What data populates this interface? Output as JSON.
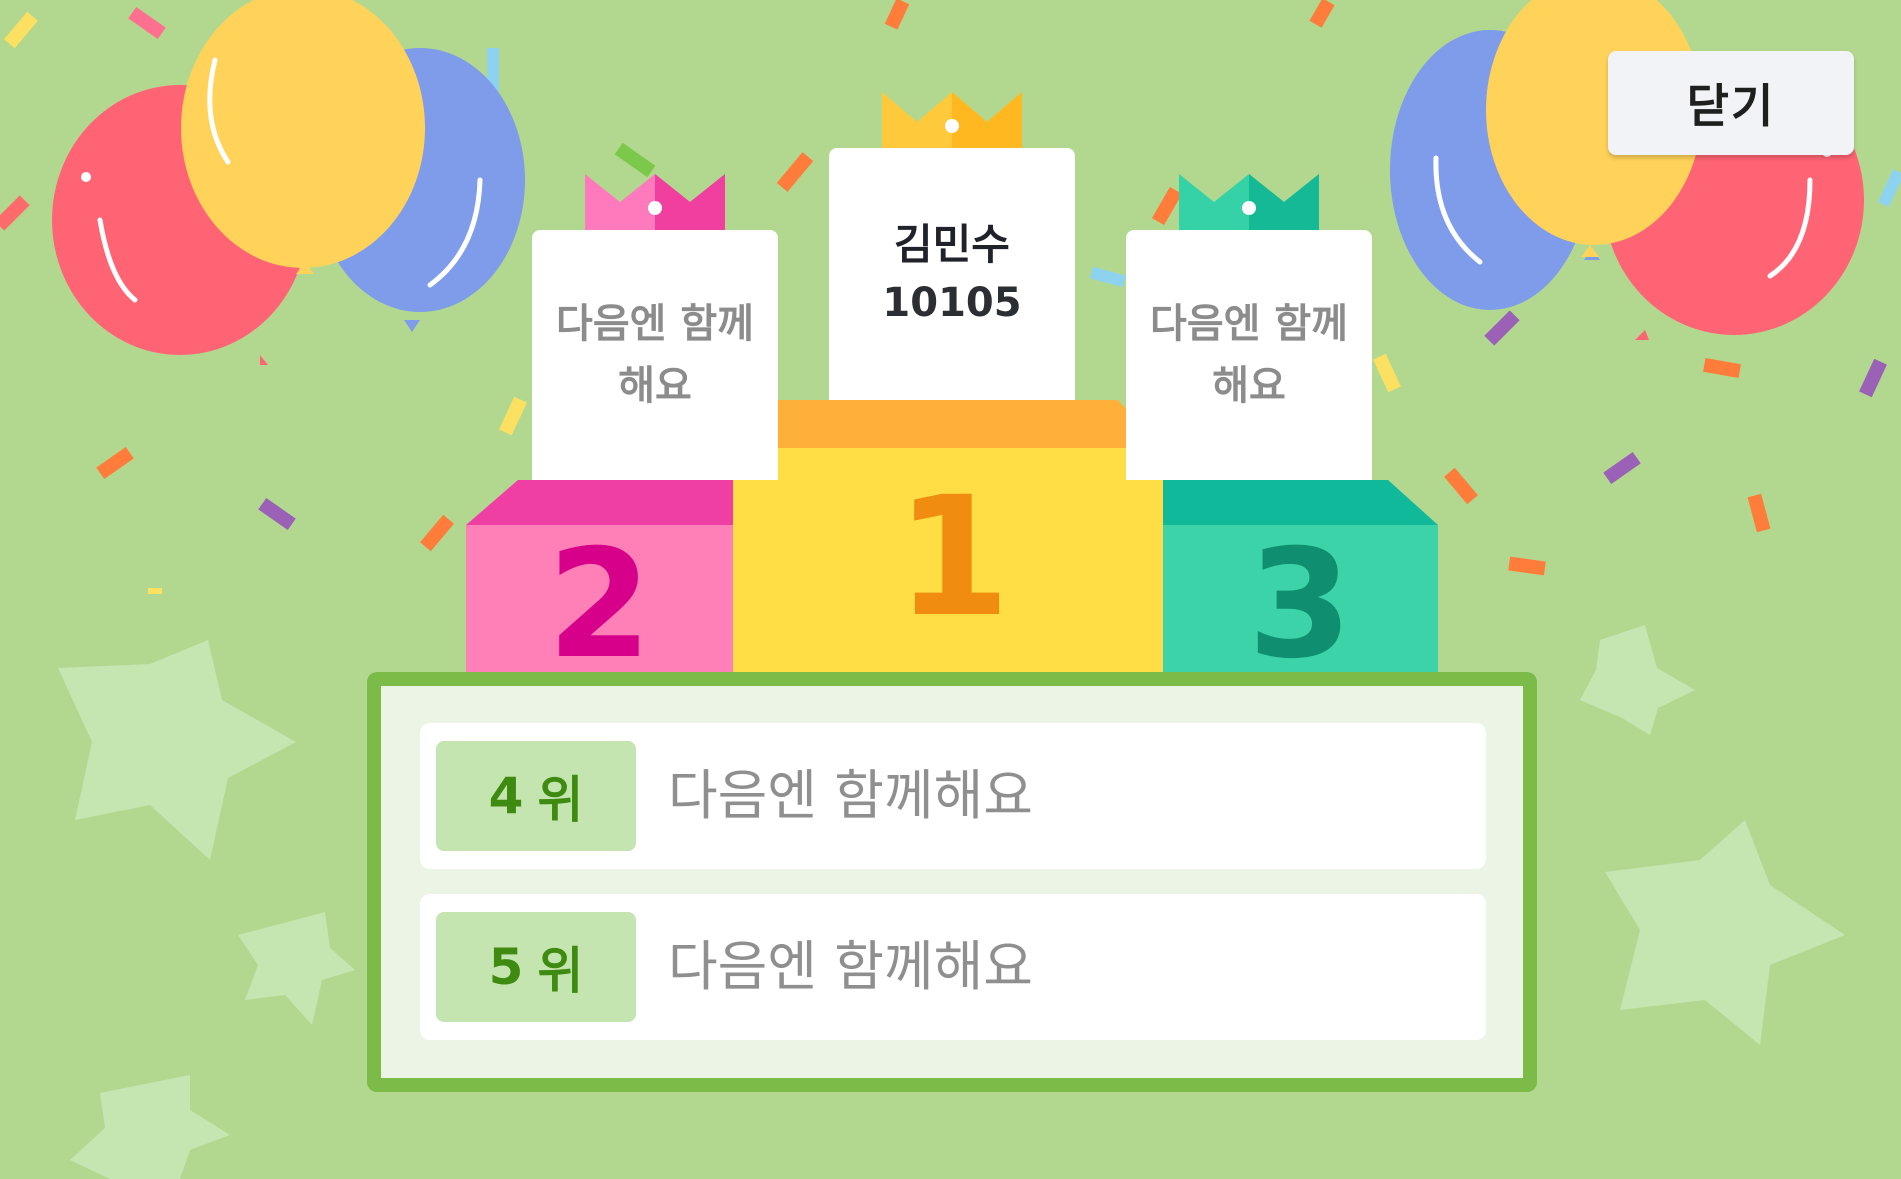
{
  "close_label": "닫기",
  "podium": {
    "first": {
      "rank": "1",
      "name": "김민수",
      "number": "10105"
    },
    "second": {
      "rank": "2",
      "text": "다음엔 함께해요"
    },
    "third": {
      "rank": "3",
      "text": "다음엔 함께해요"
    }
  },
  "list": [
    {
      "rank_num": "4",
      "rank_suffix": "위",
      "text": "다음엔 함께해요"
    },
    {
      "rank_num": "5",
      "rank_suffix": "위",
      "text": "다음엔 함께해요"
    }
  ],
  "colors": {
    "background": "#b2d890",
    "gold": "#ffdd44",
    "pink": "#ff80b6",
    "teal": "#3bd3a7",
    "panel_border": "#7cbb47"
  }
}
